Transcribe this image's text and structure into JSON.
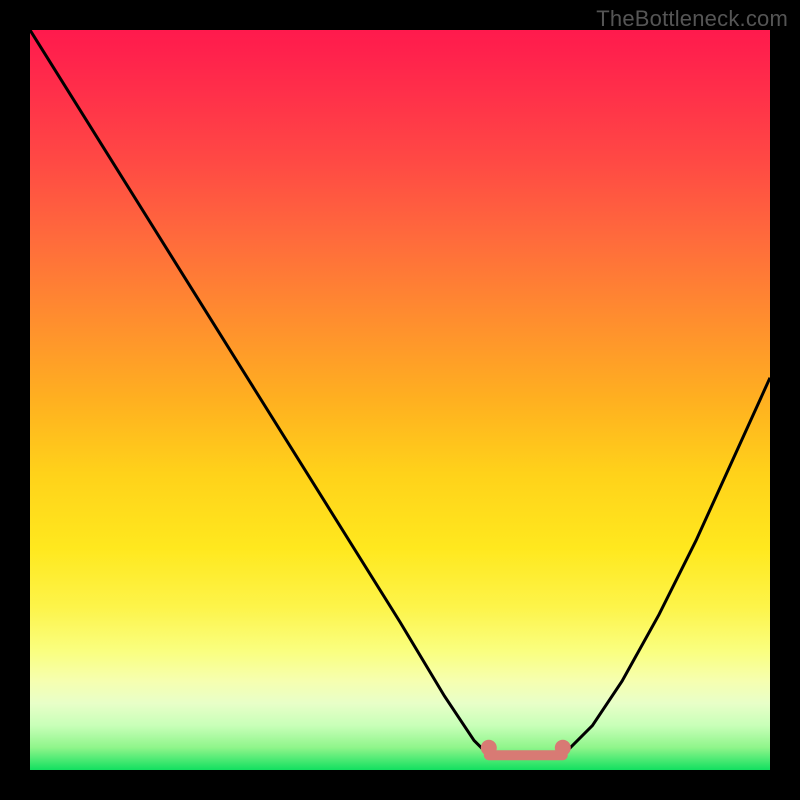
{
  "watermark": "TheBottleneck.com",
  "chart_data": {
    "type": "line",
    "title": "",
    "xlabel": "",
    "ylabel": "",
    "xlim": [
      0,
      100
    ],
    "ylim": [
      0,
      100
    ],
    "curve_left": {
      "x": [
        0,
        10,
        20,
        30,
        40,
        50,
        56,
        60,
        62
      ],
      "y": [
        100,
        84,
        68,
        52,
        36,
        20,
        10,
        4,
        2
      ]
    },
    "curve_right": {
      "x": [
        72,
        76,
        80,
        85,
        90,
        95,
        100
      ],
      "y": [
        2,
        6,
        12,
        21,
        31,
        42,
        53
      ]
    },
    "flat_band": {
      "x_start": 62,
      "x_end": 72,
      "y": 2
    },
    "marker_dots": [
      {
        "x": 62,
        "y": 3
      },
      {
        "x": 72,
        "y": 3
      }
    ],
    "gradient_stops": [
      {
        "pct": 0,
        "color": "#ff1a4d"
      },
      {
        "pct": 50,
        "color": "#ffb020"
      },
      {
        "pct": 80,
        "color": "#fdf44a"
      },
      {
        "pct": 100,
        "color": "#12e060"
      }
    ],
    "colors": {
      "curve": "#000000",
      "flat_band": "#d87a74",
      "dot": "#d87a74",
      "background_frame": "#000000"
    }
  }
}
